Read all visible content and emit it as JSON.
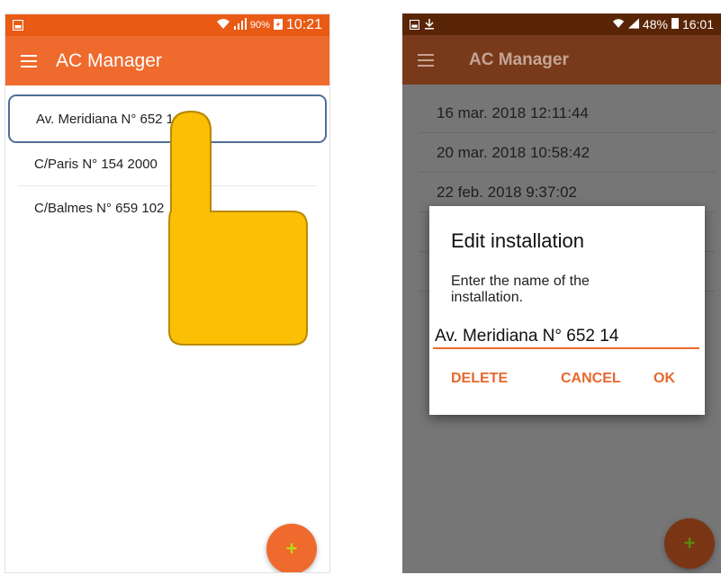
{
  "left": {
    "status": {
      "battery": "90%",
      "time": "10:21"
    },
    "appbar": {
      "title": "AC Manager"
    },
    "installations": [
      "Av. Meridiana N° 652 14",
      "C/Paris N° 154 2000",
      "C/Balmes N° 659 102"
    ],
    "fab": "+"
  },
  "right": {
    "status": {
      "battery": "48%",
      "time": "16:01"
    },
    "appbar": {
      "title": "AC Manager"
    },
    "dates": [
      "16 mar. 2018 12:11:44",
      "20 mar. 2018 10:58:42",
      "22 feb. 2018 9:37:02",
      "",
      ""
    ],
    "dialog": {
      "title": "Edit installation",
      "message": "Enter the name of the installation.",
      "value": "Av. Meridiana N° 652 14",
      "delete": "DELETE",
      "cancel": "CANCEL",
      "ok": "OK"
    },
    "fab": "+"
  },
  "colors": {
    "primary": "#ef6a2d",
    "statusbar": "#e95a14",
    "accent_text": "#e4692f",
    "selection": "#4f6e96",
    "hand": "#fbbf06"
  }
}
